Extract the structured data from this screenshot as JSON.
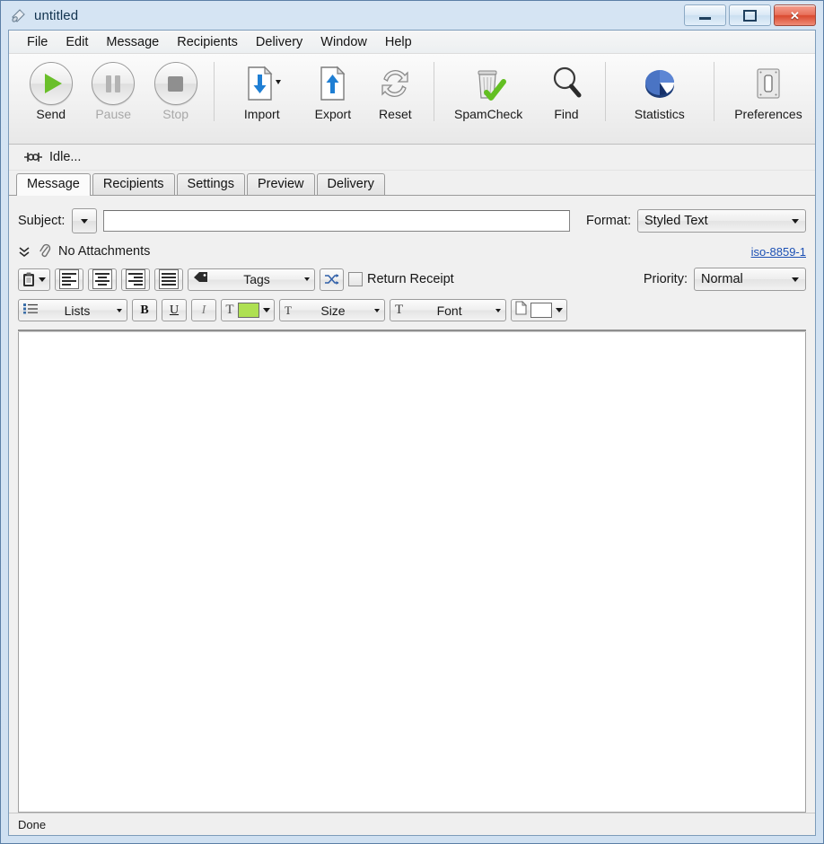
{
  "window": {
    "title": "untitled",
    "app_icon": "megaphone-icon",
    "controls": {
      "minimize": "minimize-icon",
      "maximize": "maximize-icon",
      "close": "✕"
    }
  },
  "menubar": {
    "items": [
      {
        "label": "File"
      },
      {
        "label": "Edit"
      },
      {
        "label": "Message"
      },
      {
        "label": "Recipients"
      },
      {
        "label": "Delivery"
      },
      {
        "label": "Window"
      },
      {
        "label": "Help"
      }
    ]
  },
  "toolbar": {
    "buttons": [
      {
        "label": "Send",
        "icon": "play-icon",
        "enabled": true
      },
      {
        "label": "Pause",
        "icon": "pause-icon",
        "enabled": false
      },
      {
        "label": "Stop",
        "icon": "stop-icon",
        "enabled": false
      },
      {
        "label": "Import",
        "icon": "document-down-arrow-icon",
        "enabled": true,
        "has_dropdown": true
      },
      {
        "label": "Export",
        "icon": "document-up-arrow-icon",
        "enabled": true
      },
      {
        "label": "Reset",
        "icon": "refresh-arrows-icon",
        "enabled": true
      },
      {
        "label": "SpamCheck",
        "icon": "trash-check-icon",
        "enabled": true
      },
      {
        "label": "Find",
        "icon": "magnifier-icon",
        "enabled": true
      },
      {
        "label": "Statistics",
        "icon": "pie-chart-icon",
        "enabled": true
      },
      {
        "label": "Preferences",
        "icon": "light-switch-icon",
        "enabled": true
      }
    ]
  },
  "status_strip": {
    "icon": "connector-icon",
    "text": "Idle..."
  },
  "tabs": [
    {
      "label": "Message",
      "active": true
    },
    {
      "label": "Recipients",
      "active": false
    },
    {
      "label": "Settings",
      "active": false
    },
    {
      "label": "Preview",
      "active": false
    },
    {
      "label": "Delivery",
      "active": false
    }
  ],
  "message": {
    "subject_label": "Subject:",
    "subject_value": "",
    "subject_placeholder": "",
    "format_label": "Format:",
    "format_value": "Styled Text",
    "attachments_text": "No Attachments",
    "attachments_expander": "chevron-double-down-icon",
    "attachments_icon": "paperclip-icon",
    "charset_link": "iso-8859-1",
    "priority_label": "Priority:",
    "priority_value": "Normal",
    "return_receipt_label": "Return Receipt",
    "return_receipt_checked": false,
    "tags_label": "Tags",
    "lists_label": "Lists",
    "size_label": "Size",
    "font_label": "Font",
    "bold_label": "B",
    "underline_label": "U",
    "italic_label": "I",
    "text_color_label": "T",
    "size_icon_label": "T",
    "font_icon_label": "T",
    "text_color_swatch": "#aee052",
    "page_color_swatch": "#ffffff",
    "body_value": ""
  },
  "statusbar": {
    "text": "Done"
  },
  "colors": {
    "accent_green": "#6abf2a",
    "link_blue": "#1c50b4",
    "title_blue": "#12334f",
    "close_red": "#d9492f"
  }
}
